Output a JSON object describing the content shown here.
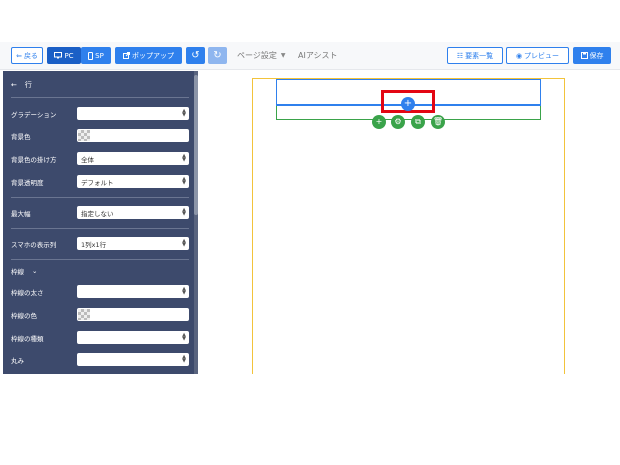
{
  "toolbar": {
    "back_label": "戻る",
    "pc_label": "PC",
    "sp_label": "SP",
    "popup_label": "ポップアップ",
    "page_settings_label": "ページ設定",
    "ai_assist_label": "AIアシスト",
    "elements_label": "要素一覧",
    "preview_label": "プレビュー",
    "save_label": "保存"
  },
  "sidebar": {
    "title": "行",
    "fields": {
      "gradient": {
        "label": "グラデーション",
        "value": ""
      },
      "bg_color": {
        "label": "背景色"
      },
      "bg_apply": {
        "label": "背景色の掛け方",
        "value": "全体"
      },
      "bg_opacity": {
        "label": "背景透明度",
        "value": "デフォルト"
      },
      "max_width": {
        "label": "最大幅",
        "value": "指定しない"
      },
      "sp_columns": {
        "label": "スマホの表示列",
        "value": "1列x1行"
      },
      "border_width": {
        "label": "枠線の太さ",
        "value": ""
      },
      "border_color": {
        "label": "枠線の色"
      },
      "border_type": {
        "label": "枠線の種類",
        "value": ""
      },
      "radius": {
        "label": "丸み",
        "value": ""
      }
    },
    "border_section_label": "枠線"
  },
  "colors": {
    "accent": "#2f80ed",
    "sidebar_bg": "#3d4a6c",
    "highlight": "#e30613",
    "green": "#3aa34a",
    "canvas_border": "#f2c33b"
  }
}
